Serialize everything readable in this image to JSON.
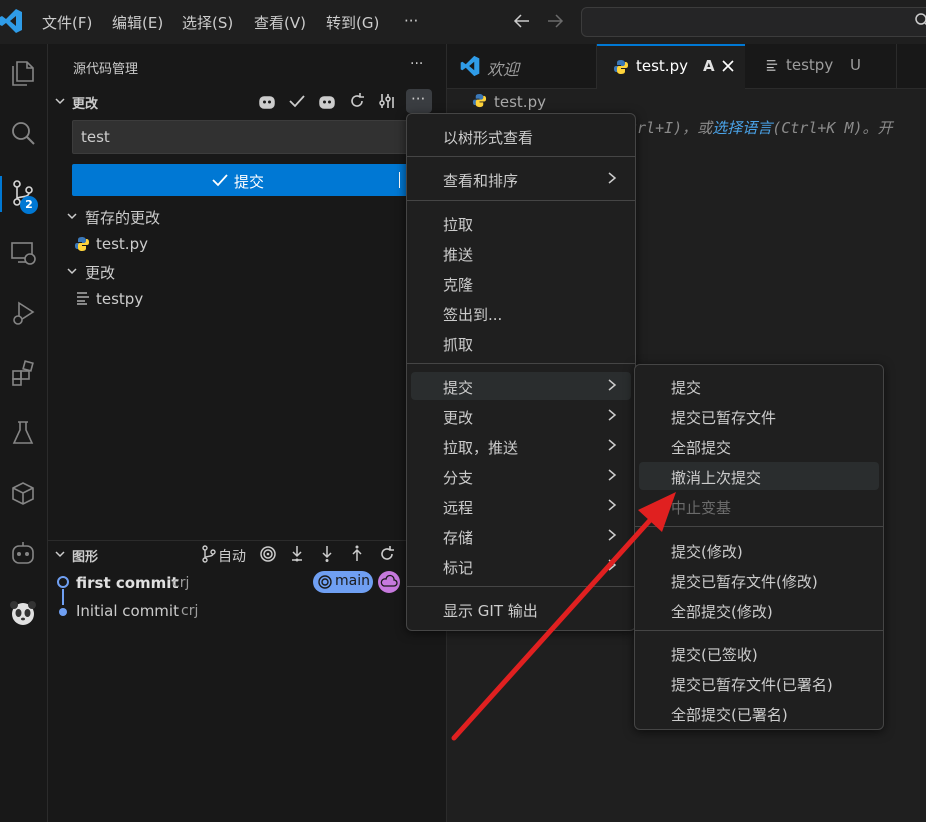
{
  "titlebar": {
    "menus": [
      "文件(F)",
      "编辑(E)",
      "选择(S)",
      "查看(V)",
      "转到(G)",
      "···"
    ]
  },
  "activity": {
    "scm_badge": "2"
  },
  "sidebar": {
    "title": "源代码管理",
    "changes_header": "更改",
    "commit_input_value": "test",
    "commit_button": "提交",
    "staged_header": "暂存的更改",
    "staged_files": [
      "test.py"
    ],
    "changes_group": "更改",
    "change_files": [
      "testpy"
    ],
    "graph_header": "图形",
    "graph_auto": "自动",
    "commits": [
      {
        "message": "first commit",
        "author": "crj",
        "branch": "main"
      },
      {
        "message": "Initial commit",
        "author": "crj"
      }
    ]
  },
  "editor": {
    "tabs": [
      {
        "label": "欢迎"
      },
      {
        "label": "test.py",
        "status": "A"
      },
      {
        "label": "testpy",
        "status": "U"
      }
    ],
    "breadcrumb": "test.py",
    "content_fragment": [
      {
        "text": "trl+I)，或",
        "link": false
      },
      {
        "text": "选择语言",
        "link": true
      },
      {
        "text": "(Ctrl+K M)。开",
        "link": false
      }
    ]
  },
  "menu1": {
    "items": [
      {
        "label": "以树形式查看"
      },
      {
        "label": "查看和排序",
        "submenu": true
      },
      {
        "label": "拉取"
      },
      {
        "label": "推送"
      },
      {
        "label": "克隆"
      },
      {
        "label": "签出到..."
      },
      {
        "label": "抓取"
      },
      {
        "label": "提交",
        "submenu": true,
        "highlight": true
      },
      {
        "label": "更改",
        "submenu": true
      },
      {
        "label": "拉取，推送",
        "submenu": true
      },
      {
        "label": "分支",
        "submenu": true
      },
      {
        "label": "远程",
        "submenu": true
      },
      {
        "label": "存储",
        "submenu": true
      },
      {
        "label": "标记",
        "submenu": true
      },
      {
        "label": "显示 GIT 输出"
      }
    ]
  },
  "menu2": {
    "items": [
      {
        "label": "提交"
      },
      {
        "label": "提交已暂存文件"
      },
      {
        "label": "全部提交"
      },
      {
        "label": "撤消上次提交",
        "highlight": true
      },
      {
        "label": "中止变基",
        "disabled": true
      },
      {
        "label": "提交(修改)"
      },
      {
        "label": "提交已暂存文件(修改)"
      },
      {
        "label": "全部提交(修改)"
      },
      {
        "label": "提交(已签收)"
      },
      {
        "label": "提交已暂存文件(已署名)"
      },
      {
        "label": "全部提交(已署名)"
      }
    ]
  },
  "colors": {
    "accent": "#0078d4",
    "badge": "#0078d4",
    "annotation_arrow": "#e02020",
    "branch_badge": "#6f9ff2",
    "cloud_badge": "#c679dd"
  }
}
